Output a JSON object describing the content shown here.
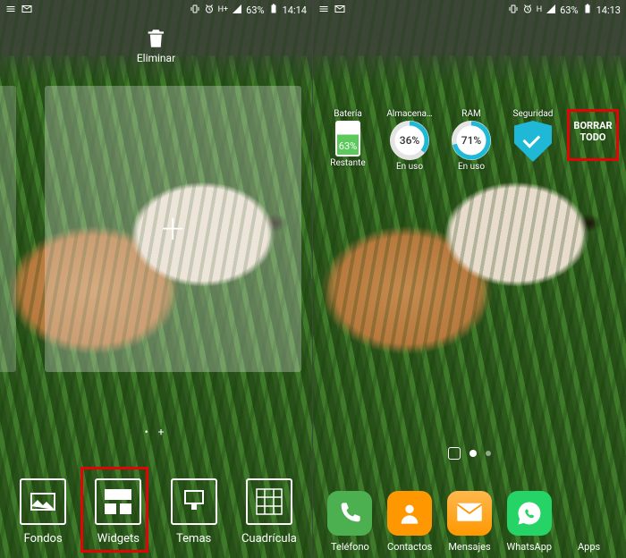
{
  "left": {
    "status": {
      "battery_pct": "63%",
      "time": "14:14",
      "net": "H+"
    },
    "trash_label": "Eliminar",
    "page_dots": "•  +",
    "buttons": [
      {
        "name": "fondos",
        "label": "Fondos"
      },
      {
        "name": "widgets",
        "label": "Widgets"
      },
      {
        "name": "temas",
        "label": "Temas"
      },
      {
        "name": "cuadricula",
        "label": "Cuadrícula"
      }
    ],
    "highlight_target": "widgets"
  },
  "right": {
    "status": {
      "battery_pct": "63%",
      "time": "14:13",
      "net": "H"
    },
    "widgets": {
      "battery": {
        "top": "Batería",
        "value": "63%",
        "bottom": "Restante",
        "color": "#5cc95c"
      },
      "storage": {
        "top": "Almacena…",
        "value": "36%",
        "bottom": "En uso",
        "color": "#1fb8d6",
        "pct": 36
      },
      "ram": {
        "top": "RAM",
        "value": "71%",
        "bottom": "En uso",
        "color": "#1fb8d6",
        "pct": 71
      },
      "security": {
        "top": "Seguridad"
      },
      "clear_all": "BORRAR TODO"
    },
    "dock": [
      {
        "name": "telefono",
        "label": "Teléfono"
      },
      {
        "name": "contactos",
        "label": "Contactos"
      },
      {
        "name": "mensajes",
        "label": "Mensajes"
      },
      {
        "name": "whatsapp",
        "label": "WhatsApp"
      },
      {
        "name": "apps",
        "label": "Apps"
      }
    ],
    "highlight_target": "clear_all"
  }
}
